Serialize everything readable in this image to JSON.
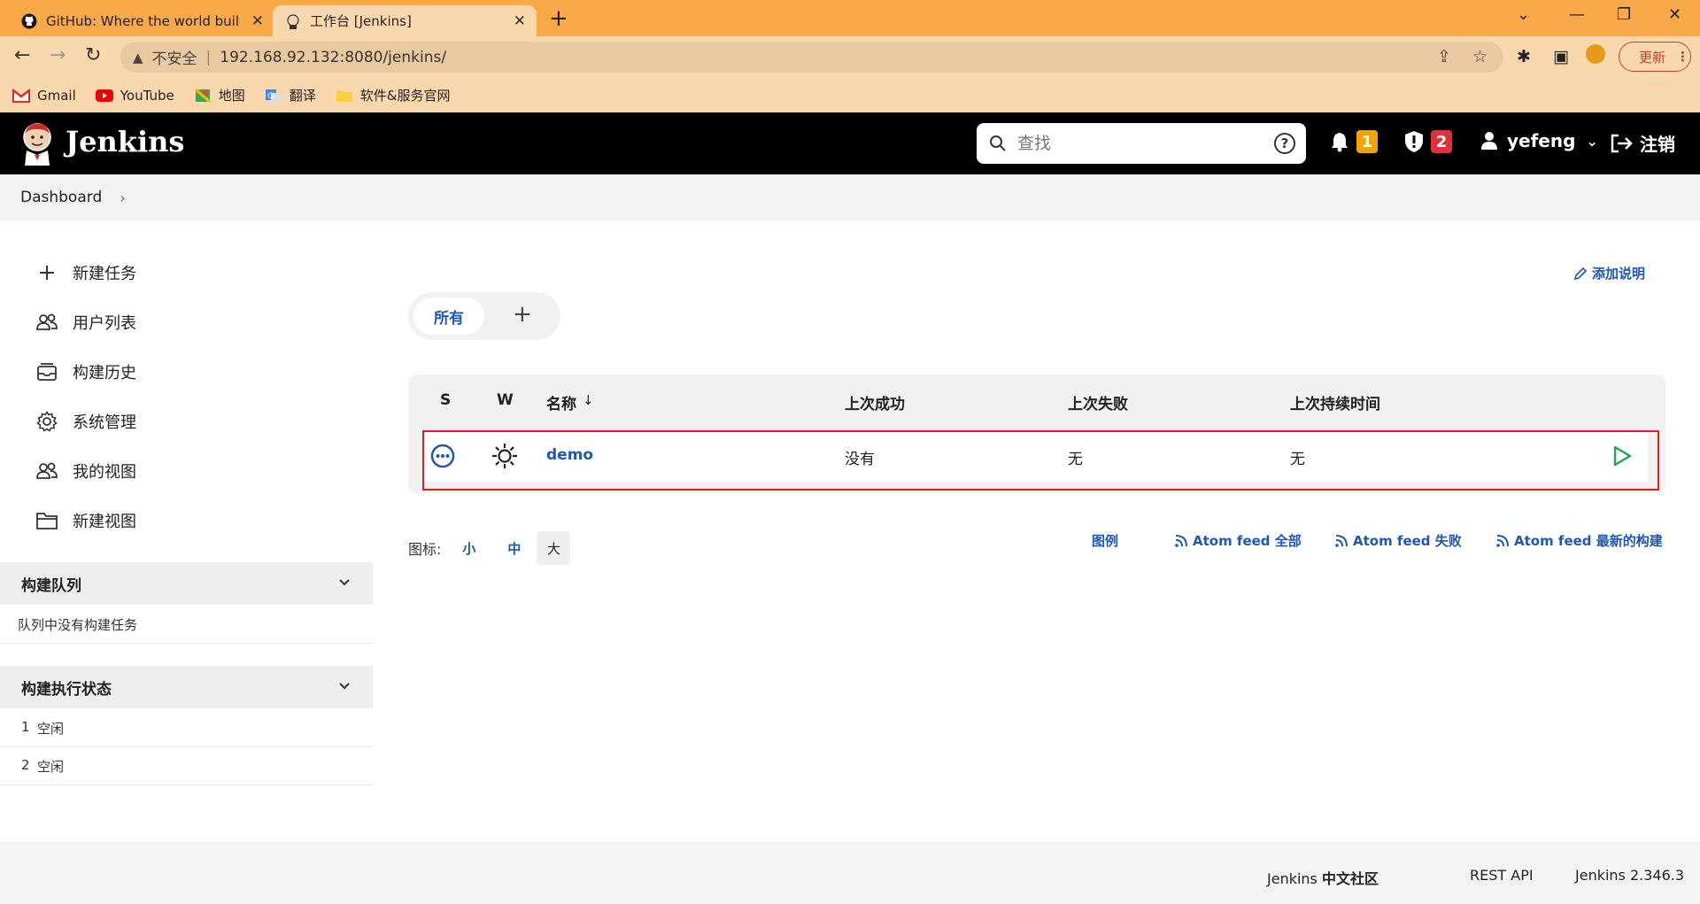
{
  "browser": {
    "tabs": [
      {
        "title": "GitHub: Where the world build",
        "active": false
      },
      {
        "title": "工作台 [Jenkins]",
        "active": true
      }
    ],
    "address": {
      "security_label": "不安全",
      "url": "192.168.92.132:8080/jenkins/"
    },
    "update_label": "更新",
    "bookmarks": [
      "Gmail",
      "YouTube",
      "地图",
      "翻译",
      "软件&服务官网"
    ]
  },
  "header": {
    "app_name": "Jenkins",
    "search_placeholder": "查找",
    "notifications_count": "1",
    "security_count": "2",
    "user_name": "yefeng",
    "logout_label": "注销"
  },
  "breadcrumb": {
    "item": "Dashboard"
  },
  "sidebar": {
    "items": [
      {
        "label": "新建任务",
        "icon": "plus-icon"
      },
      {
        "label": "用户列表",
        "icon": "people-icon"
      },
      {
        "label": "构建历史",
        "icon": "history-icon"
      },
      {
        "label": "系统管理",
        "icon": "gear-icon"
      },
      {
        "label": "我的视图",
        "icon": "people-icon"
      },
      {
        "label": "新建视图",
        "icon": "folder-icon"
      }
    ],
    "build_queue": {
      "title": "构建队列",
      "empty_text": "队列中没有构建任务"
    },
    "executors": {
      "title": "构建执行状态",
      "rows": [
        {
          "num": "1",
          "status": "空闲"
        },
        {
          "num": "2",
          "status": "空闲"
        }
      ]
    }
  },
  "main": {
    "add_description": "添加说明",
    "view_tabs": {
      "all": "所有",
      "add": "+"
    },
    "table": {
      "columns": {
        "s": "S",
        "w": "W",
        "name": "名称",
        "sort_arrow": "↓",
        "last_success": "上次成功",
        "last_failure": "上次失败",
        "last_duration": "上次持续时间"
      },
      "rows": [
        {
          "name": "demo",
          "last_success": "没有",
          "last_failure": "无",
          "last_duration": "无"
        }
      ]
    },
    "icon_size": {
      "label": "图标:",
      "small": "小",
      "medium": "中",
      "large": "大"
    },
    "feeds": {
      "legend": "图例",
      "all": "Atom feed 全部",
      "failed": "Atom feed 失败",
      "latest": "Atom feed 最新的构建"
    }
  },
  "footer": {
    "community_prefix": "Jenkins",
    "community_suffix": "中文社区",
    "rest_api": "REST API",
    "version": "Jenkins 2.346.3"
  },
  "colors": {
    "accent": "#1e57b6",
    "header_bg": "#000000",
    "browser_bg": "#f8a94a",
    "badge_orange": "#f0a500",
    "badge_red": "#e0303a",
    "run_green": "#1ea64b"
  }
}
